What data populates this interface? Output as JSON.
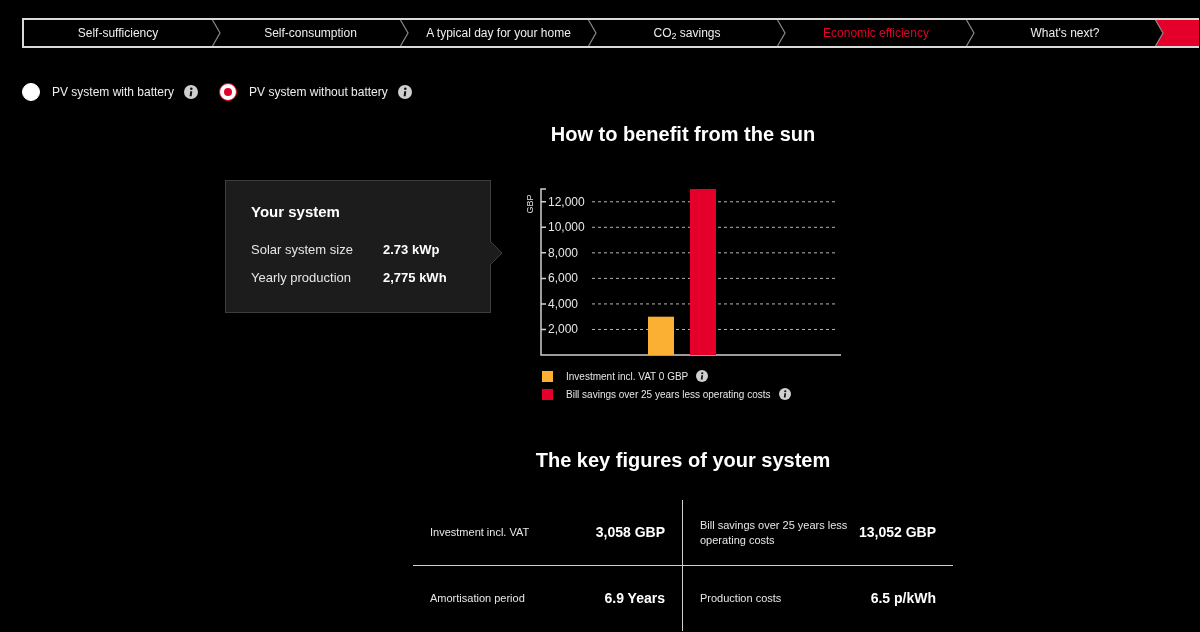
{
  "nav_tabs": [
    {
      "label": "Self-sufficiency",
      "selected": false
    },
    {
      "label": "Self-consumption",
      "selected": false
    },
    {
      "label": "A typical day for your home",
      "selected": false
    },
    {
      "label": "CO$_{2}$ savings",
      "selected": false
    },
    {
      "label": "Economic efficiency",
      "selected": true
    },
    {
      "label": "What's next?",
      "selected": false
    }
  ],
  "system_options": [
    {
      "label": "PV system with battery",
      "selected": false
    },
    {
      "label": "PV system without battery",
      "selected": true
    }
  ],
  "benefit_section": {
    "title": "How to benefit from the sun",
    "system_card": {
      "title": "Your system",
      "rows": [
        {
          "label": "Solar system size",
          "value": "2.73 kWp"
        },
        {
          "label": "Yearly production",
          "value": "2,775 kWh"
        }
      ]
    },
    "chart_data": {
      "type": "bar",
      "ylabel": "GBP",
      "grid": true,
      "legend": "bottom",
      "series": [
        {
          "name": "Investment incl. VAT 0 GBP",
          "color": "#fbb034",
          "values": [
            3000
          ]
        },
        {
          "name": "Bill savings over 25 years less operating costs",
          "color": "#e4002b",
          "values": [
            13000
          ]
        }
      ],
      "ylim": [
        0,
        13000
      ],
      "yticks": [
        {
          "value": 2000,
          "label": "2,000"
        },
        {
          "value": 4000,
          "label": "4,000"
        },
        {
          "value": 6000,
          "label": "6,000"
        },
        {
          "value": 8000,
          "label": "8,000"
        },
        {
          "value": 10000,
          "label": "10,000"
        },
        {
          "value": 12000,
          "label": "12,000"
        }
      ]
    }
  },
  "key_figures": {
    "title": "The key figures of your system",
    "rows": [
      {
        "cells": [
          {
            "label": "Investment incl. VAT",
            "value": "3,058 GBP"
          },
          {
            "label": "Bill savings over 25 years less operating costs",
            "value": "13,052 GBP"
          }
        ]
      },
      {
        "cells": [
          {
            "label": "Amortisation period",
            "value": "6.9 Years"
          },
          {
            "label": "Production costs",
            "value": "6.5 p/kWh"
          }
        ]
      }
    ]
  }
}
